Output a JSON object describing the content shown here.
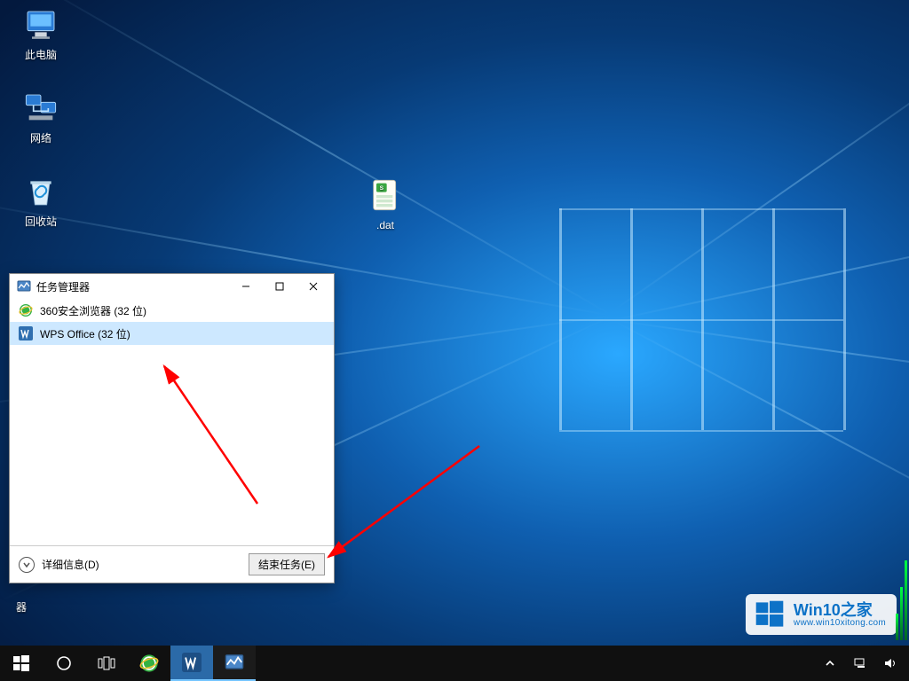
{
  "desktop": {
    "icons": {
      "this_pc": "此电脑",
      "network": "网络",
      "recycle_bin": "回收站",
      "dat_file": ".dat",
      "qi_fragment": "器"
    }
  },
  "task_manager": {
    "title": "任务管理器",
    "processes": [
      {
        "name": "360安全浏览器 (32 位)",
        "icon": "ie-green"
      },
      {
        "name": "WPS Office (32 位)",
        "icon": "wps"
      }
    ],
    "details_label": "详细信息(D)",
    "end_task_label": "结束任务(E)"
  },
  "taskbar": {
    "items": [
      {
        "id": "start",
        "icon": "windows"
      },
      {
        "id": "cortana",
        "icon": "circle"
      },
      {
        "id": "taskview",
        "icon": "taskview"
      },
      {
        "id": "browser",
        "icon": "ie-green"
      },
      {
        "id": "wps",
        "icon": "wps",
        "active": true
      },
      {
        "id": "taskmgr",
        "icon": "monitor",
        "active": true
      }
    ]
  },
  "watermark": {
    "title": "Win10之家",
    "url": "www.win10xitong.com"
  }
}
